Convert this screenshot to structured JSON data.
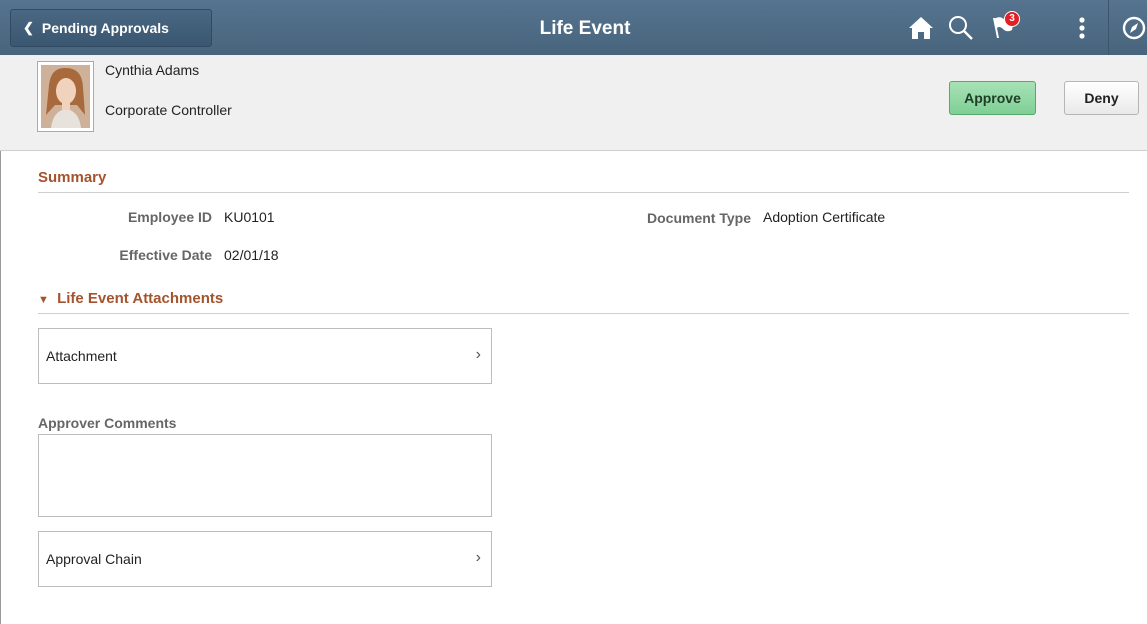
{
  "header": {
    "back_label": "Pending Approvals",
    "title": "Life Event",
    "icons": [
      "home-icon",
      "search-icon",
      "notification-flag-icon",
      "actions-menu-icon",
      "navbar-compass-icon"
    ],
    "notification_count": "3",
    "colors": {
      "bar": "#4e6b85",
      "badge": "#e31f26"
    }
  },
  "person": {
    "name": "Cynthia Adams",
    "title": "Corporate Controller"
  },
  "actions": {
    "approve_label": "Approve",
    "deny_label": "Deny",
    "approve_color": "#8fd8a2"
  },
  "summary": {
    "heading": "Summary",
    "employee_id_label": "Employee ID",
    "employee_id": "KU0101",
    "effective_date_label": "Effective Date",
    "effective_date": "02/01/18",
    "document_type_label": "Document Type",
    "document_type": "Adoption Certificate",
    "heading_color": "#a4542d"
  },
  "attachments": {
    "heading": "Life Event Attachments",
    "row_label": "Attachment"
  },
  "comments": {
    "label": "Approver Comments",
    "value": ""
  },
  "approval_chain": {
    "label": "Approval Chain"
  }
}
